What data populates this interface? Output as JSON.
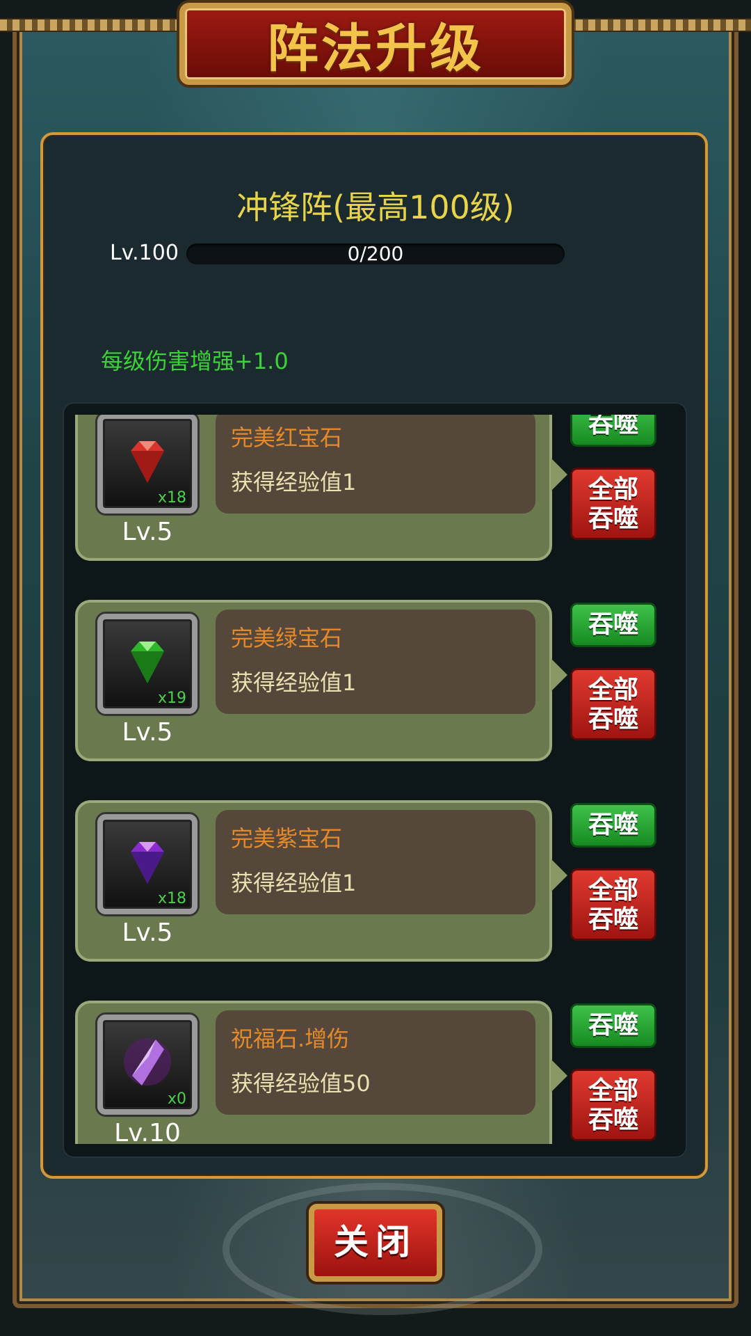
{
  "title": "阵法升级",
  "formation": {
    "name": "冲锋阵(最高100级)",
    "level_label": "Lv.100",
    "exp_text": "0/200",
    "exp_current": 0,
    "exp_max": 200,
    "bonus": "每级伤害增强+1.0"
  },
  "items": [
    {
      "name": "完美红宝石",
      "exp": "获得经验值1",
      "qty": "x18",
      "level": "Lv.5",
      "icon": "red-gem-icon",
      "color": "#d8342c"
    },
    {
      "name": "完美绿宝石",
      "exp": "获得经验值1",
      "qty": "x19",
      "level": "Lv.5",
      "icon": "green-gem-icon",
      "color": "#2fb52a"
    },
    {
      "name": "完美紫宝石",
      "exp": "获得经验值1",
      "qty": "x18",
      "level": "Lv.5",
      "icon": "purple-gem-icon",
      "color": "#8a2bd0"
    },
    {
      "name": "祝福石.增伤",
      "exp": "获得经验值50",
      "qty": "x0",
      "level": "Lv.10",
      "icon": "blessing-crystal-icon",
      "color": "#b070e0"
    }
  ],
  "buttons": {
    "devour": "吞噬",
    "devour_all_line1": "全部",
    "devour_all_line2": "吞噬",
    "close": "关闭"
  }
}
